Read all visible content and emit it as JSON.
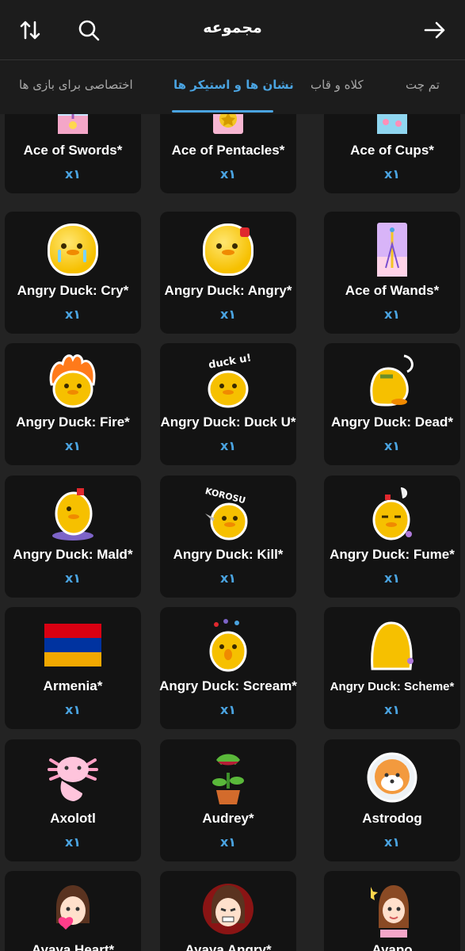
{
  "header": {
    "title": "مجموعه",
    "sort_icon": "sort-icon",
    "search_icon": "search-icon",
    "forward_icon": "arrow-right-icon"
  },
  "tabs": [
    {
      "label": "تم چت",
      "active": false
    },
    {
      "label": "کلاه و قاب",
      "active": false
    },
    {
      "label": "نشان ها و استیکر ها",
      "active": true
    },
    {
      "label": "اختصاصی برای بازی ها",
      "active": false
    }
  ],
  "colors": {
    "accent": "#4aa3e0",
    "background": "#232323",
    "card": "#131313",
    "header": "#1c1c1c"
  },
  "items": [
    {
      "name": "Ace of Swords*",
      "count": "x۱",
      "icon": "tarot-swords-icon"
    },
    {
      "name": "Ace of Pentacles*",
      "count": "x۱",
      "icon": "tarot-pentacles-icon"
    },
    {
      "name": "Ace of Cups*",
      "count": "x۱",
      "icon": "tarot-cups-icon"
    },
    {
      "name": "Angry Duck: Cry*",
      "count": "x۱",
      "icon": "duck-cry-icon"
    },
    {
      "name": "Angry Duck: Angry*",
      "count": "x۱",
      "icon": "duck-angry-icon"
    },
    {
      "name": "Ace of Wands*",
      "count": "x۱",
      "icon": "tarot-wands-icon"
    },
    {
      "name": "Angry Duck: Fire*",
      "count": "x۱",
      "icon": "duck-fire-icon"
    },
    {
      "name": "Angry Duck: Duck U*",
      "count": "x۱",
      "icon": "duck-duck-u-icon"
    },
    {
      "name": "Angry Duck: Dead*",
      "count": "x۱",
      "icon": "duck-dead-icon"
    },
    {
      "name": "Angry Duck: Mald*",
      "count": "x۱",
      "icon": "duck-mald-icon"
    },
    {
      "name": "Angry Duck: Kill*",
      "count": "x۱",
      "icon": "duck-kill-icon"
    },
    {
      "name": "Angry Duck: Fume*",
      "count": "x۱",
      "icon": "duck-fume-icon"
    },
    {
      "name": "Armenia*",
      "count": "x۱",
      "icon": "armenia-flag-icon"
    },
    {
      "name": "Angry Duck: Scream*",
      "count": "x۱",
      "icon": "duck-scream-icon"
    },
    {
      "name": "Angry Duck: Scheme*",
      "count": "x۱",
      "icon": "duck-scheme-icon"
    },
    {
      "name": "Axolotl",
      "count": "x۱",
      "icon": "axolotl-icon"
    },
    {
      "name": "Audrey*",
      "count": "x۱",
      "icon": "plant-icon"
    },
    {
      "name": "Astrodog",
      "count": "x۱",
      "icon": "astrodog-icon"
    },
    {
      "name": "Ayaya Heart*",
      "count": "",
      "icon": "ayaya-heart-icon"
    },
    {
      "name": "Ayaya Angry*",
      "count": "",
      "icon": "ayaya-angry-icon"
    },
    {
      "name": "Ayapo",
      "count": "",
      "icon": "ayapo-icon"
    }
  ],
  "duck_dialog": {
    "duck_u_text": "duck u!",
    "kill_text": "KOROSU"
  }
}
